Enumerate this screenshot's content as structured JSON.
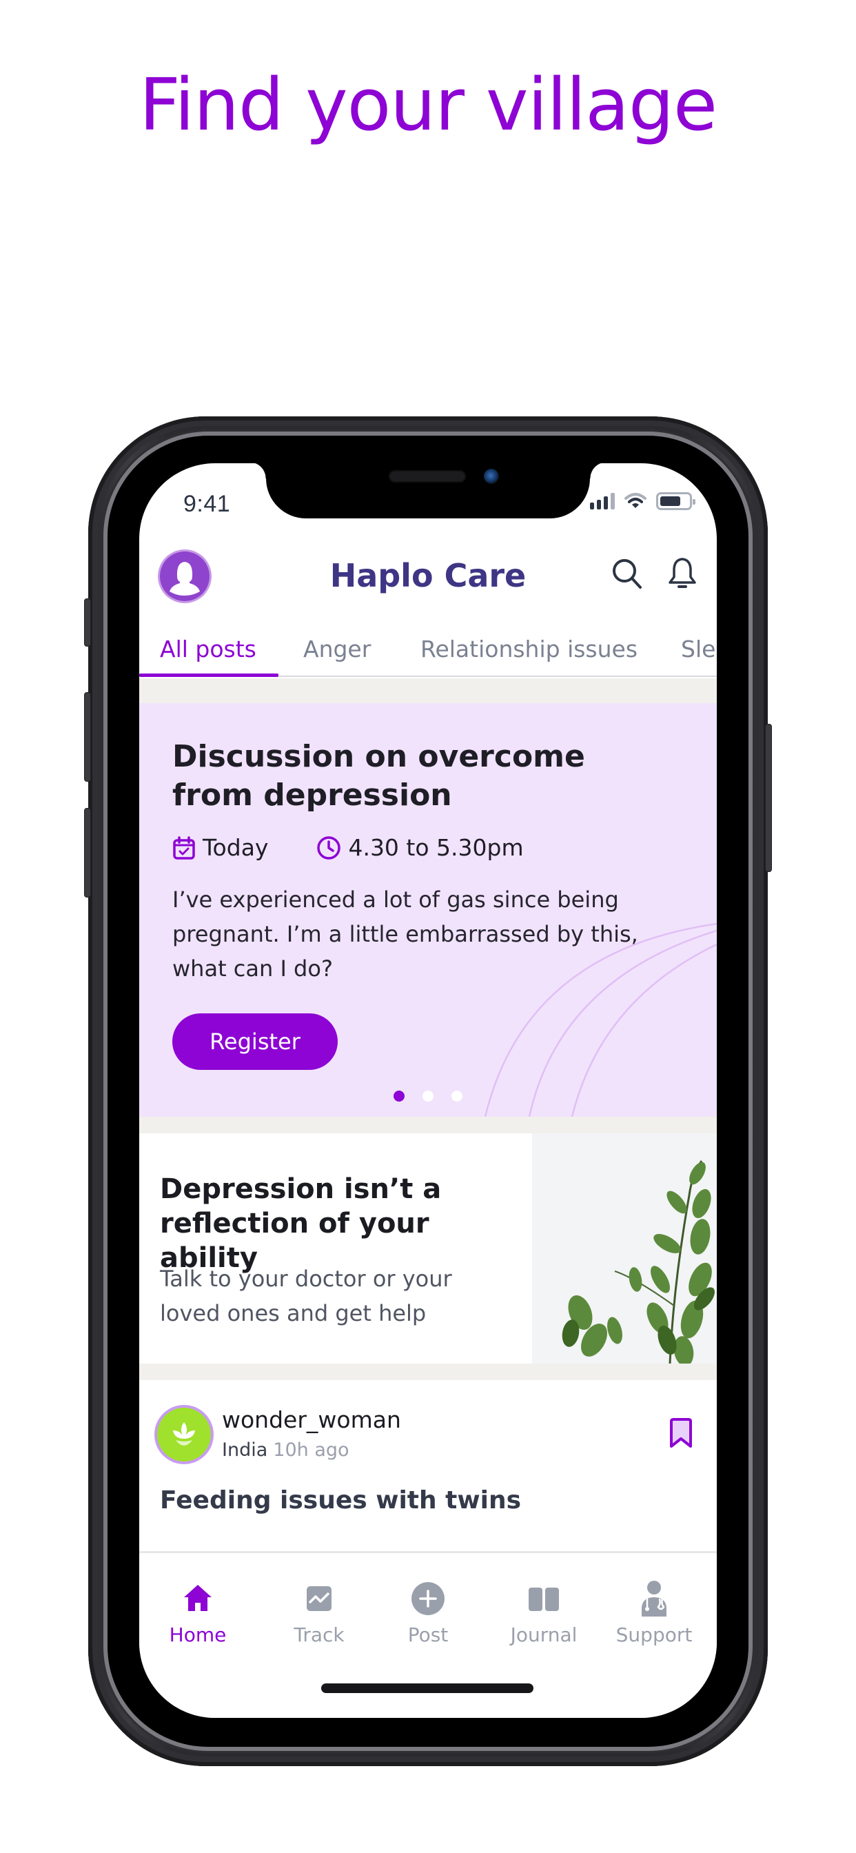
{
  "headline": "Find your village",
  "status_bar": {
    "time": "9:41"
  },
  "header": {
    "title": "Haplo Care"
  },
  "tabs": [
    {
      "label": "All posts",
      "active": true
    },
    {
      "label": "Anger",
      "active": false
    },
    {
      "label": "Relationship issues",
      "active": false
    },
    {
      "label": "Slee",
      "active": false
    }
  ],
  "promo": {
    "title": "Discussion on overcome from depression",
    "date": "Today",
    "time": "4.30 to 5.30pm",
    "body": "I’ve experienced a lot of gas since being pregnant. I’m a little embarrassed by this, what can I do?",
    "button": "Register",
    "carousel": {
      "current": 1,
      "total": 3
    }
  },
  "quote_card": {
    "title": "Depression isn’t a reflection of your ability",
    "body": "Talk to your doctor or your loved ones and get help"
  },
  "post": {
    "username": "wonder_woman",
    "country": "India",
    "time_ago": "10h ago",
    "title": "Feeding issues with twins"
  },
  "bottom_nav": [
    {
      "label": "Home",
      "icon": "home-icon",
      "active": true
    },
    {
      "label": "Track",
      "icon": "chart-icon",
      "active": false
    },
    {
      "label": "Post",
      "icon": "plus-circle-icon",
      "active": false
    },
    {
      "label": "Journal",
      "icon": "book-icon",
      "active": false
    },
    {
      "label": "Support",
      "icon": "doctor-icon",
      "active": false
    }
  ],
  "colors": {
    "brand": "#8d04d4",
    "title": "#3e3585",
    "promo_bg": "#f1e3fc",
    "muted": "#9aa0ab"
  }
}
